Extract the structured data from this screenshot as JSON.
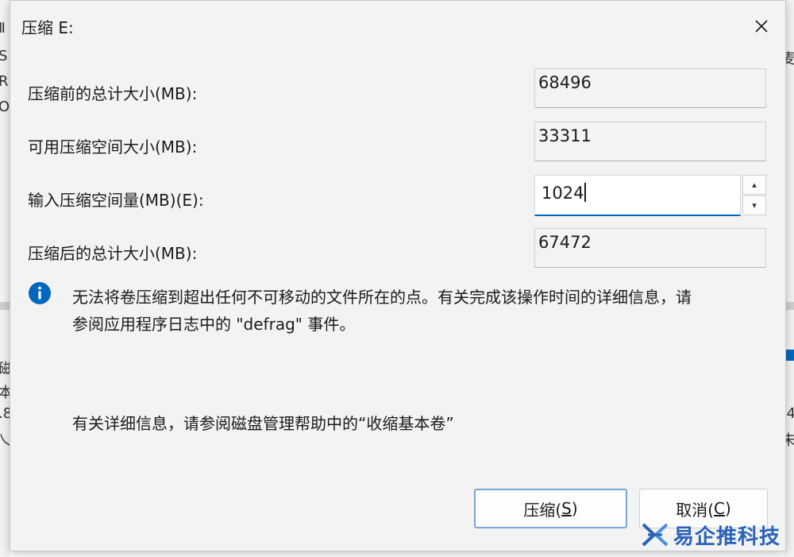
{
  "dialog": {
    "title": "压缩 E:",
    "fields": [
      {
        "label": "压缩前的总计大小(MB):",
        "value": "68496"
      },
      {
        "label": "可用压缩空间大小(MB):",
        "value": "33311"
      },
      {
        "label": "输入压缩空间量(MB)(E):",
        "value": "1024"
      },
      {
        "label": "压缩后的总计大小(MB):",
        "value": "67472"
      }
    ],
    "info_line1": "无法将卷压缩到超出任何不可移动的文件所在的点。有关完成该操作时间的详细信息，请",
    "info_line2": "参阅应用程序日志中的 \"defrag\" 事件。",
    "help_text": "有关详细信息，请参阅磁盘管理帮助中的“收缩基本卷”",
    "buttons": {
      "shrink": {
        "label": "压缩(",
        "accel": "S",
        "suffix": ")"
      },
      "cancel": {
        "label": "取消(",
        "accel": "C",
        "suffix": ")"
      }
    }
  },
  "watermark": {
    "text": "易企推科技"
  },
  "icons": {
    "close": "close-icon",
    "info": "info-icon",
    "spin_up": "spin-up-icon",
    "spin_down": "spin-down-icon"
  },
  "colors": {
    "accent": "#0067c0",
    "info": "#0067c0",
    "watermark": "#2a63b8"
  }
}
